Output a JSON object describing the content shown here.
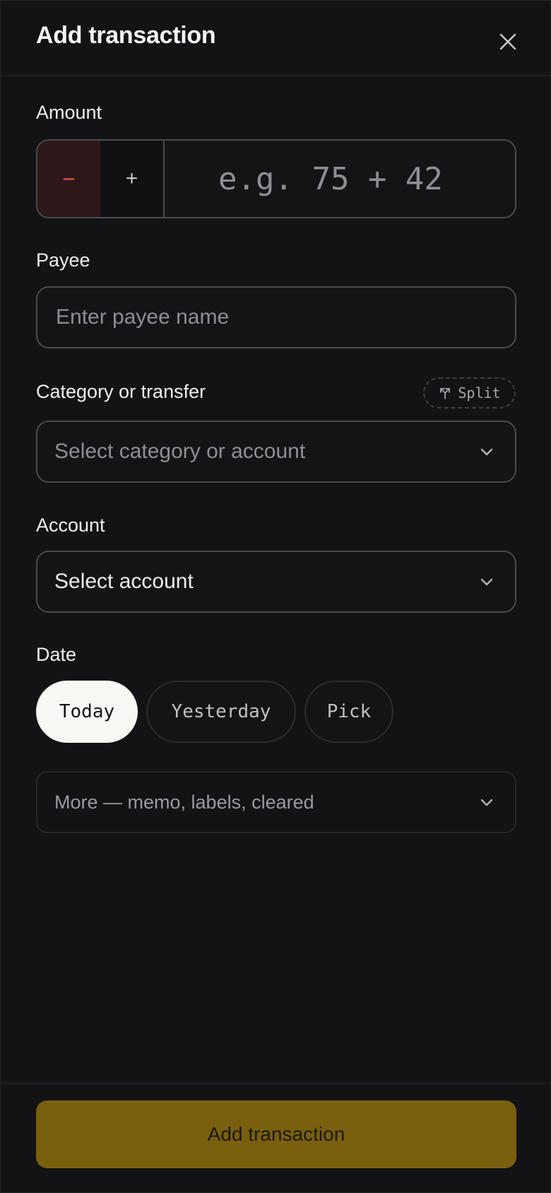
{
  "header": {
    "title": "Add transaction",
    "close_icon": "close-icon"
  },
  "amount": {
    "label": "Amount",
    "minus_label": "−",
    "plus_label": "+",
    "placeholder": "e.g. 75 + 42",
    "value": ""
  },
  "payee": {
    "label": "Payee",
    "placeholder": "Enter payee name",
    "value": ""
  },
  "category": {
    "label": "Category or transfer",
    "split_label": "Split",
    "split_icon": "split-arrows-icon",
    "value": "Select category or account",
    "chevron_icon": "chevron-down-icon"
  },
  "account": {
    "label": "Account",
    "value": "Select account",
    "chevron_icon": "chevron-down-icon"
  },
  "date": {
    "label": "Date",
    "options": [
      {
        "label": "Today",
        "selected": true
      },
      {
        "label": "Yesterday",
        "selected": false
      },
      {
        "label": "Pick",
        "selected": false
      }
    ]
  },
  "more": {
    "label": "More — memo, labels, cleared",
    "chevron_icon": "chevron-down-icon"
  },
  "footer": {
    "submit_label": "Add transaction"
  },
  "colors": {
    "background": "#131316",
    "accent": "#7a5f0e",
    "negative": "#e0504a",
    "negative_bg": "#2e1718",
    "border": "#4a4a50"
  }
}
